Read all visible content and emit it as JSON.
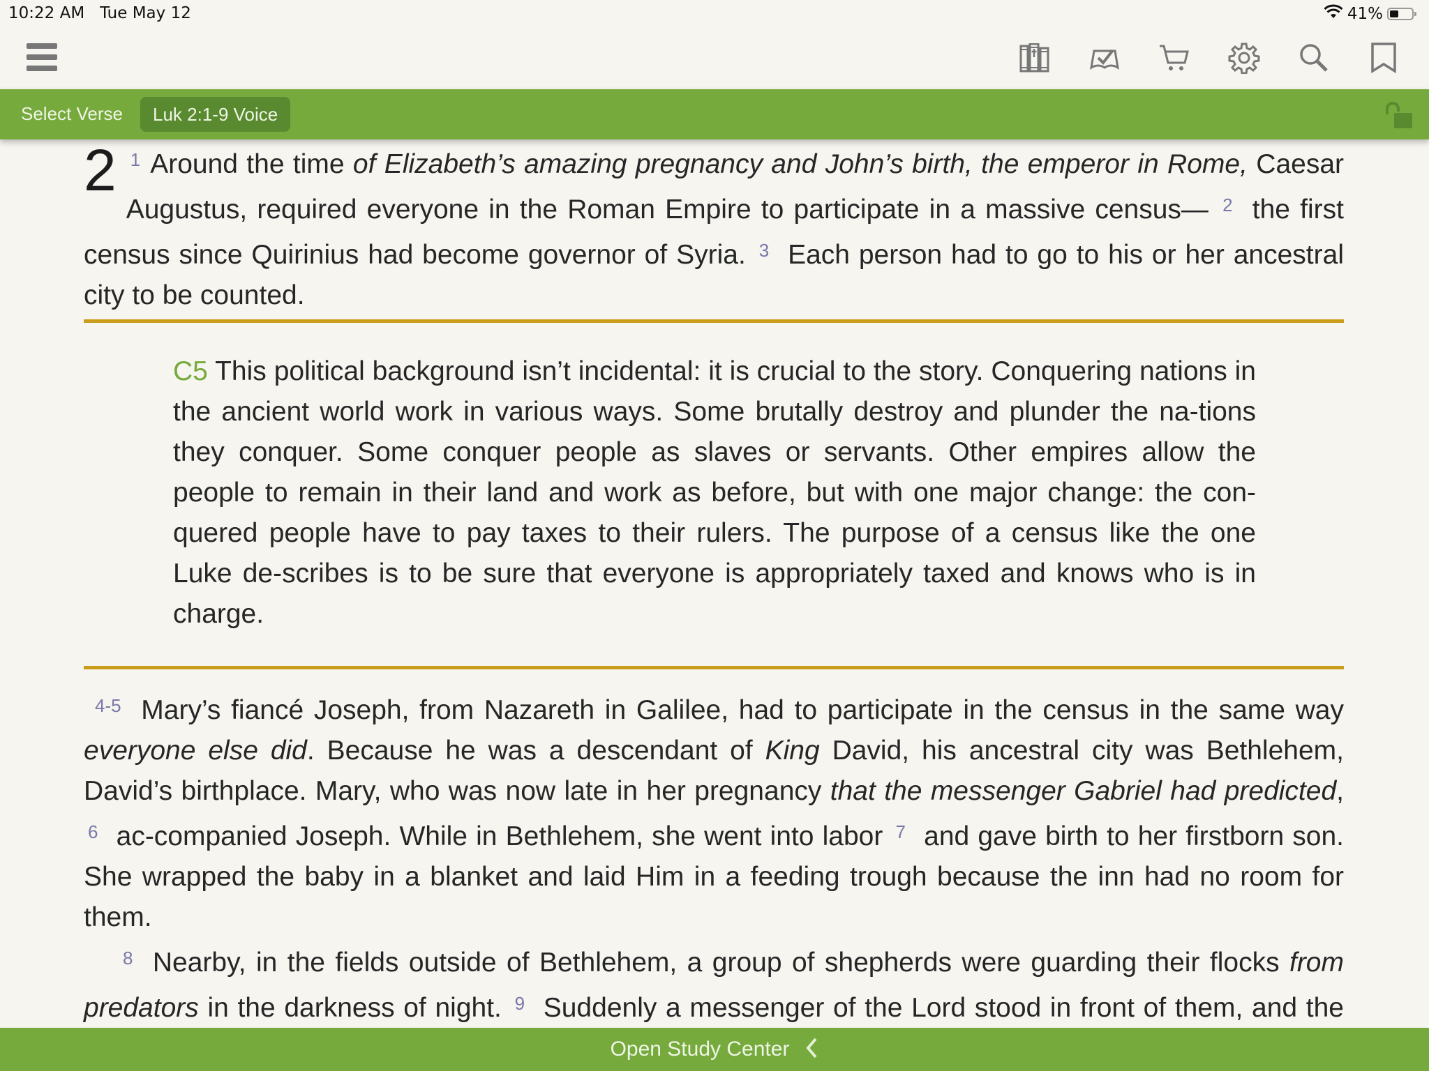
{
  "status_bar": {
    "time": "10:22 AM",
    "date": "Tue May 12",
    "battery_percent": "41%",
    "battery_level": 0.41
  },
  "toolbar": {
    "icons": [
      "library-icon",
      "reading-plan-icon",
      "store-cart-icon",
      "settings-gear-icon",
      "search-icon",
      "bookmark-icon"
    ]
  },
  "verse_bar": {
    "select_verse_label": "Select Verse",
    "reference_label": "Luk 2:1-9 Voice",
    "lock_icon": "unlocked-padlock-icon"
  },
  "colors": {
    "accent_green": "#76aa3c",
    "pill_green": "#5a8a30",
    "rule_gold": "#c99c1c",
    "verse_number": "#7a78a8",
    "background": "#f6f5f0"
  },
  "passage": {
    "chapter": "2",
    "p1": {
      "v1": "1",
      "v1_a": "Around the time ",
      "v1_i": "of Elizabeth’s amazing pregnancy and John’s birth, the emperor in Rome,",
      "v1_b": " Caesar Augustus, required everyone in the Roman Empire to participate in a massive census—",
      "v2": "2",
      "v2_text": "the first census since Quirinius had become governor of Syria.",
      "v3": "3",
      "v3_text": "Each person had to go to his or her ancestral city to be counted."
    },
    "commentary": {
      "ref": "C5",
      "text": " This political background isn’t incidental: it is crucial to the story. Conquering nations in the ancient world work in various ways. Some brutally destroy and plunder the na-tions they conquer. Some conquer people as slaves or servants. Other empires allow the people to remain in their land and work as before, but with one major change: the con-quered people have to pay taxes to their rulers. The purpose of a census like the one Luke de-scribes is to be sure that everyone is appropriately taxed and knows who is in charge."
    },
    "p2": {
      "v45": "4-5",
      "a": "Mary’s fiancé Joseph, from Nazareth in Galilee, had to participate in the census in the same way ",
      "i1": "everyone else did",
      "b": ". Because he was a descendant of ",
      "i2": "King",
      "c": " David, his ancestral city was Bethlehem, David’s birthplace. Mary, who was now late in her pregnancy ",
      "i3": "that the messenger Gabriel had predicted",
      "d": ",",
      "v6": "6",
      "v6_text": "ac-companied Joseph. While in Bethlehem, she went into labor",
      "v7": "7",
      "v7_text": "and gave birth to her firstborn son. She wrapped the baby in a blanket and laid Him in a feeding trough because the inn had no room for them."
    },
    "p3": {
      "v8": "8",
      "v8_a": "Nearby, in the fields outside of Bethlehem, a group of shepherds were guarding their flocks ",
      "v8_i": "from predators",
      "v8_b": " in the darkness of night.",
      "v9": "9",
      "v9_text": "Suddenly a messenger of the Lord stood in front of them, and the darkness was replaced by a glorious light—the shining light of God’s glory. They were terrified!"
    }
  },
  "bottom_bar": {
    "label": "Open Study Center",
    "icon": "chevron-left-icon"
  }
}
